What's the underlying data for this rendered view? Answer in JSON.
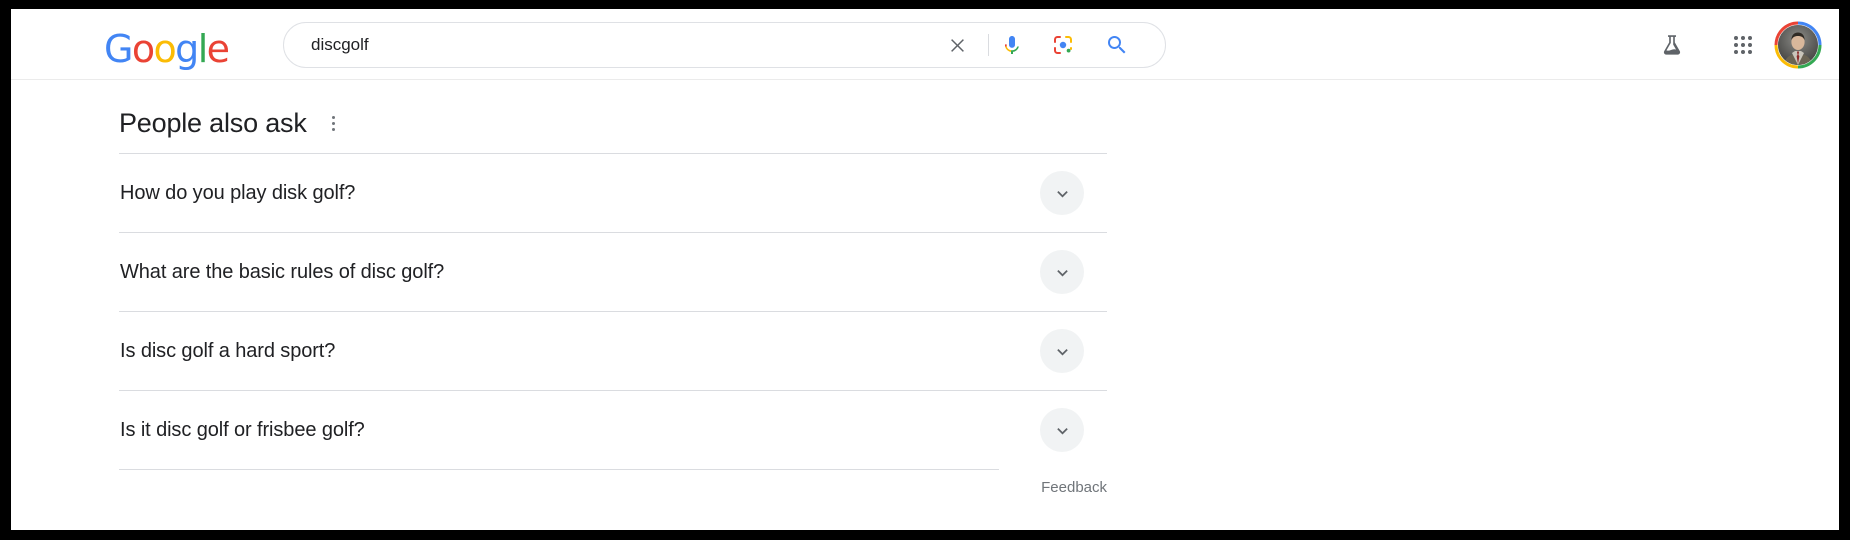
{
  "browser": {
    "frame_color": "#000000",
    "page_background": "#ffffff"
  },
  "header": {
    "logo": {
      "name": "Google",
      "letters": [
        {
          "char": "G",
          "color": "#4285F4"
        },
        {
          "char": "o",
          "color": "#EA4335"
        },
        {
          "char": "o",
          "color": "#FBBC05"
        },
        {
          "char": "g",
          "color": "#4285F4"
        },
        {
          "char": "l",
          "color": "#34A853"
        },
        {
          "char": "e",
          "color": "#EA4335"
        }
      ]
    },
    "search": {
      "value": "discgolf",
      "placeholder": "Search",
      "clear_label": "Clear",
      "mic_label": "Search by voice",
      "lens_label": "Search by image",
      "search_label": "Google Search"
    },
    "labs_label": "Google Labs",
    "apps_label": "Google apps",
    "account_label": "Google Account"
  },
  "main": {
    "people_also_ask": {
      "title": "People also ask",
      "menu_label": "About this result",
      "expand_label": "Expand",
      "questions": [
        {
          "text": "How do you play disk golf?"
        },
        {
          "text": "What are the basic rules of disc golf?"
        },
        {
          "text": "Is disc golf a hard sport?"
        },
        {
          "text": "Is it disc golf or frisbee golf?"
        }
      ],
      "feedback_label": "Feedback"
    }
  },
  "colors": {
    "google_blue": "#4285F4",
    "google_red": "#EA4335",
    "google_yellow": "#FBBC05",
    "google_green": "#34A853",
    "text_primary": "#202124",
    "text_secondary": "#70757a",
    "divider": "#dadce0",
    "chip_background": "#f1f3f4"
  }
}
